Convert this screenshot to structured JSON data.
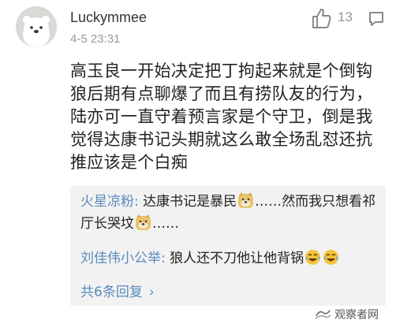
{
  "comment": {
    "username": "Luckymmee",
    "timestamp": "4-5 23:31",
    "like_count": "13",
    "text": "高玉良一开始决定把丁拘起来就是个倒钩狼后期有点聊爆了而且有捞队友的行为，陆亦可一直守着预言家是个守卫，倒是我觉得达康书记头期就这么敢全场乱怼还抗推应该是个白痴"
  },
  "replies": [
    {
      "author": "火星凉粉:",
      "text_a": " 达康书记是暴民",
      "text_b": "……然而我只想看祁厅长哭坟",
      "text_c": "……"
    },
    {
      "author": "刘佳伟小公举:",
      "text_a": " 狼人还不刀他让他背锅"
    }
  ],
  "more_replies": "共6条回复",
  "watermark": {
    "text": "观察者网"
  },
  "colors": {
    "accent": "#5b8bbd",
    "reply_bg": "#f2f2f2",
    "meta": "#999999"
  }
}
